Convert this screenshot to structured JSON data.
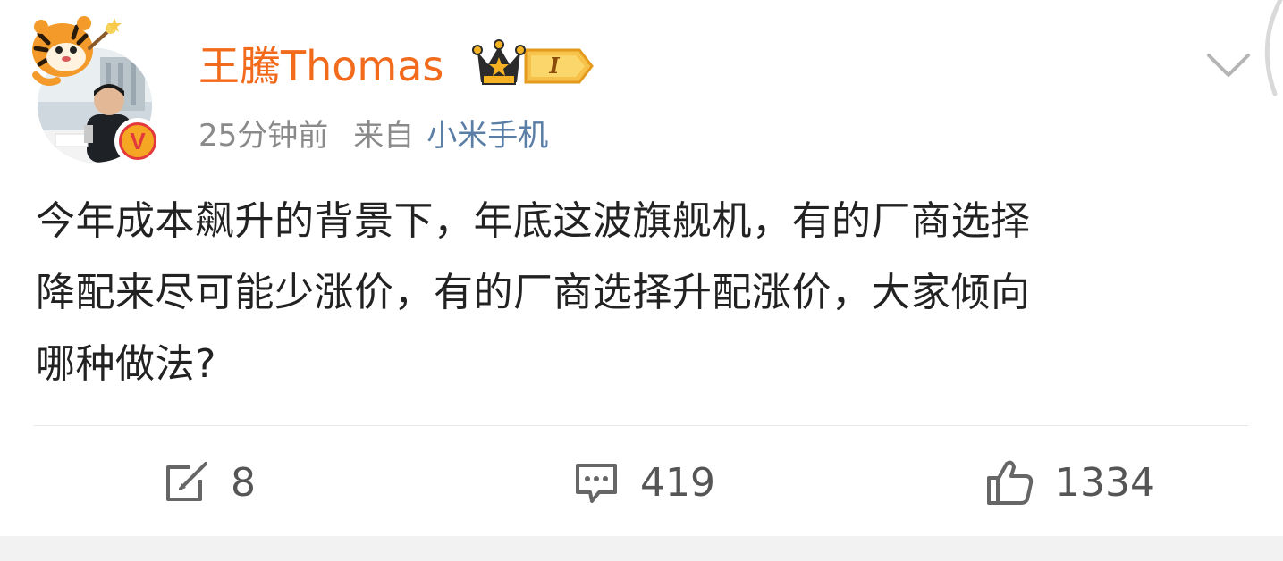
{
  "post": {
    "author": {
      "name": "王騰Thomas",
      "avatar_icon": "avatar-photo",
      "verified_icon": "verified-v-badge",
      "verified_mark": "V",
      "badge_icon": "crown-level-badge",
      "badge_text": "I"
    },
    "meta": {
      "time": "25分钟前",
      "from_label": "来自",
      "device": "小米手机"
    },
    "content_lines": [
      "今年成本飙升的背景下，年底这波旗舰机，有的厂商选择",
      "降配来尽可能少涨价，有的厂商选择升配涨价，大家倾向",
      "哪种做法?"
    ],
    "actions": {
      "repost": {
        "icon": "repost-icon",
        "count": "8"
      },
      "comment": {
        "icon": "comment-icon",
        "count": "419"
      },
      "like": {
        "icon": "thumbs-up-icon",
        "count": "1334"
      }
    },
    "menu_icon": "chevron-down-icon"
  },
  "colors": {
    "username": "#f26b1d",
    "meta": "#8a8a8a",
    "device_link": "#5a7ea6",
    "text": "#222222",
    "divider": "#e8e8e8"
  }
}
